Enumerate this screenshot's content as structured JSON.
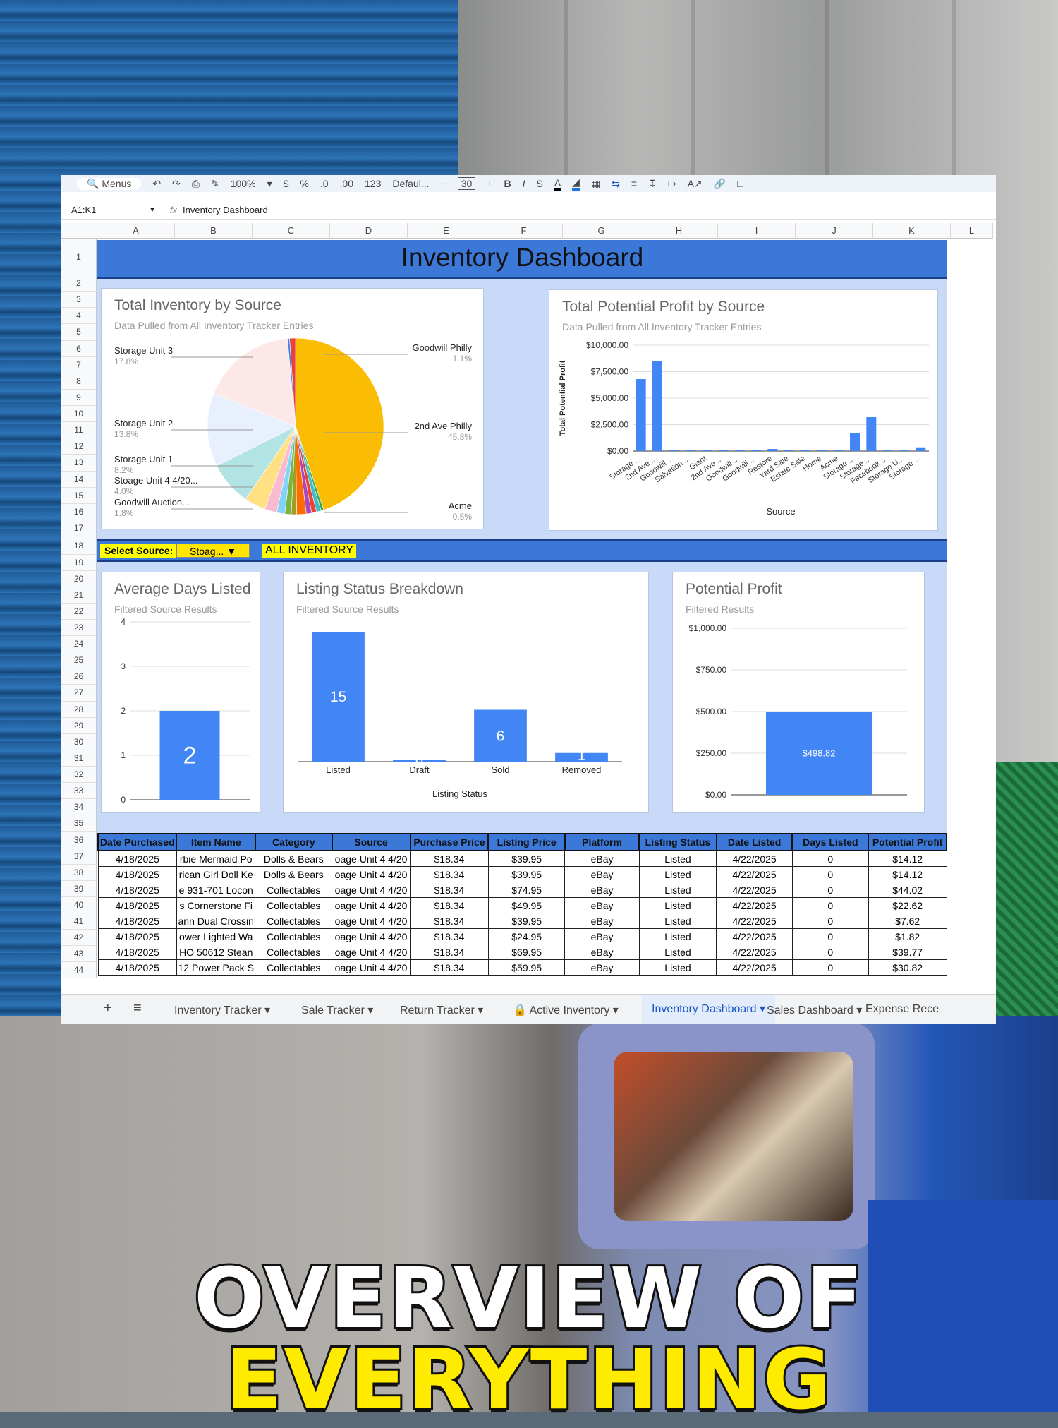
{
  "caption": {
    "line1": "OVERVIEW OF",
    "line2": "EVERYTHING"
  },
  "toolbar": {
    "menus": "Menus",
    "zoom": "100%",
    "currency": "$",
    "percent": "%",
    "dec_less": ".0",
    "dec_more": ".00",
    "number_format": "123",
    "font": "Defaul...",
    "font_size": "30",
    "bold": "B",
    "italic": "I",
    "strike": "S",
    "text_color": "A"
  },
  "formula": {
    "cell_ref": "A1:K1",
    "fx": "fx",
    "content": "Inventory Dashboard"
  },
  "columns": [
    "A",
    "B",
    "C",
    "D",
    "E",
    "F",
    "G",
    "H",
    "I",
    "J",
    "K",
    "L"
  ],
  "rows": [
    "1",
    "2",
    "3",
    "4",
    "5",
    "6",
    "7",
    "8",
    "9",
    "10",
    "11",
    "12",
    "13",
    "14",
    "15",
    "16",
    "17",
    "18",
    "19",
    "20",
    "21",
    "22",
    "23",
    "24",
    "25",
    "26",
    "27",
    "28",
    "29",
    "30",
    "31",
    "32",
    "33",
    "34",
    "35",
    "36",
    "37",
    "38",
    "39",
    "40",
    "41",
    "42",
    "43",
    "44"
  ],
  "dashboard": {
    "title": "Inventory Dashboard"
  },
  "pie_card": {
    "title": "Total Inventory by Source",
    "subtitle": "Data Pulled from All Inventory Tracker Entries"
  },
  "profit_card": {
    "title": "Total Potential Profit by Source",
    "subtitle": "Data Pulled from All Inventory Tracker Entries",
    "ylabel": "Total Potential Profit",
    "xlabel": "Source"
  },
  "selector": {
    "label": "Select Source:",
    "value": "Stoag...",
    "all": "ALL INVENTORY"
  },
  "days_card": {
    "title": "Average Days Listed",
    "subtitle": "Filtered Source Results"
  },
  "status_card": {
    "title": "Listing Status Breakdown",
    "subtitle": "Filtered Source Results",
    "xlabel": "Listing Status"
  },
  "pp_card": {
    "title": "Potential Profit",
    "subtitle": "Filtered Results"
  },
  "chart_data": [
    {
      "type": "pie",
      "title": "Total Inventory by Source",
      "subtitle": "Data Pulled from All Inventory Tracker Entries",
      "slices": [
        {
          "label": "2nd Ave Philly",
          "value": 45.8,
          "pct": "45.8%",
          "color": "#fbbc04"
        },
        {
          "label": "Acme",
          "value": 0.5,
          "pct": "0.5%",
          "color": "#34a853"
        },
        {
          "label": "",
          "value": 0.9,
          "pct": "",
          "color": "#46bdc6"
        },
        {
          "label": "",
          "value": 0.9,
          "pct": "",
          "color": "#ea4335"
        },
        {
          "label": "",
          "value": 1.0,
          "pct": "",
          "color": "#ab47bc"
        },
        {
          "label": "Goodwill Auction...",
          "value": 1.8,
          "pct": "1.8%",
          "color": "#ff6d01"
        },
        {
          "label": "",
          "value": 1.0,
          "pct": "",
          "color": "#9e9d24"
        },
        {
          "label": "",
          "value": 1.2,
          "pct": "",
          "color": "#7cb342"
        },
        {
          "label": "",
          "value": 1.5,
          "pct": "",
          "color": "#81d4fa"
        },
        {
          "label": "",
          "value": 2.3,
          "pct": "",
          "color": "#f8bbd0"
        },
        {
          "label": "Stoage Unit 4 4/20...",
          "value": 4.0,
          "pct": "4.0%",
          "color": "#ffe082"
        },
        {
          "label": "Storage Unit 1",
          "value": 8.2,
          "pct": "8.2%",
          "color": "#b2e4e4"
        },
        {
          "label": "Storage Unit 2",
          "value": 13.8,
          "pct": "13.8%",
          "color": "#e8f0fe"
        },
        {
          "label": "Storage Unit 3",
          "value": 17.8,
          "pct": "17.8%",
          "color": "#fce8e6"
        },
        {
          "label": "",
          "value": 0.4,
          "pct": "",
          "color": "#4285f4"
        },
        {
          "label": "Goodwill Philly",
          "value": 1.1,
          "pct": "1.1%",
          "color": "#ea4335"
        }
      ]
    },
    {
      "type": "bar",
      "title": "Total Potential Profit by Source",
      "subtitle": "Data Pulled from All Inventory Tracker Entries",
      "xlabel": "Source",
      "ylabel": "Total Potential Profit",
      "ylim": [
        0,
        10000
      ],
      "yticks": [
        "$0.00",
        "$2,500.00",
        "$5,000.00",
        "$7,500.00",
        "$10,000.00"
      ],
      "grid": true,
      "categories": [
        "Storage ...",
        "2nd Ave ...",
        "Goodwill ...",
        "Salvation ...",
        "Giant",
        "2nd Ave ...",
        "Goodwill ...",
        "Goodwill ...",
        "Restore",
        "Yard Sale",
        "Estate Sale",
        "Home",
        "Acme",
        "Storage ...",
        "Storage ...",
        "Facebook ...",
        "Storage U...",
        "Storage ..."
      ],
      "values": [
        6800,
        8500,
        120,
        40,
        20,
        30,
        40,
        30,
        200,
        40,
        30,
        40,
        60,
        1700,
        3200,
        60,
        20,
        350
      ]
    },
    {
      "type": "bar",
      "title": "Average Days Listed",
      "subtitle": "Filtered Source Results",
      "categories": [
        ""
      ],
      "values": [
        2
      ],
      "ylim": [
        0,
        4
      ],
      "yticks": [
        "0",
        "1",
        "2",
        "3",
        "4"
      ],
      "data_labels": [
        "2"
      ]
    },
    {
      "type": "bar",
      "title": "Listing Status Breakdown",
      "subtitle": "Filtered Source Results",
      "xlabel": "Listing Status",
      "categories": [
        "Listed",
        "Draft",
        "Sold",
        "Removed"
      ],
      "values": [
        15,
        0,
        6,
        1
      ],
      "ylim": [
        0,
        16
      ],
      "data_labels": [
        "15",
        "0",
        "6",
        "1"
      ]
    },
    {
      "type": "bar",
      "title": "Potential Profit",
      "subtitle": "Filtered Results",
      "categories": [
        ""
      ],
      "values": [
        498.82
      ],
      "ylim": [
        0,
        1000
      ],
      "yticks": [
        "$0.00",
        "$250.00",
        "$500.00",
        "$750.00",
        "$1,000.00"
      ],
      "data_labels": [
        "$498.82"
      ]
    }
  ],
  "table": {
    "headers": [
      "Date Purchased",
      "Item Name",
      "Category",
      "Source",
      "Purchase Price",
      "Listing Price",
      "Platform",
      "Listing Status",
      "Date Listed",
      "Days Listed",
      "Potential Profit"
    ],
    "rows": [
      [
        "4/18/2025",
        "rbie Mermaid Po",
        "Dolls & Bears",
        "oage Unit 4 4/20",
        "$18.34",
        "$39.95",
        "eBay",
        "Listed",
        "4/22/2025",
        "0",
        "$14.12"
      ],
      [
        "4/18/2025",
        "rican Girl Doll Ke",
        "Dolls & Bears",
        "oage Unit 4 4/20",
        "$18.34",
        "$39.95",
        "eBay",
        "Listed",
        "4/22/2025",
        "0",
        "$14.12"
      ],
      [
        "4/18/2025",
        "e 931-701 Locon",
        "Collectables",
        "oage Unit 4 4/20",
        "$18.34",
        "$74.95",
        "eBay",
        "Listed",
        "4/22/2025",
        "0",
        "$44.02"
      ],
      [
        "4/18/2025",
        "s Cornerstone Fi",
        "Collectables",
        "oage Unit 4 4/20",
        "$18.34",
        "$49.95",
        "eBay",
        "Listed",
        "4/22/2025",
        "0",
        "$22.62"
      ],
      [
        "4/18/2025",
        "ann Dual Crossin",
        "Collectables",
        "oage Unit 4 4/20",
        "$18.34",
        "$39.95",
        "eBay",
        "Listed",
        "4/22/2025",
        "0",
        "$7.62"
      ],
      [
        "4/18/2025",
        "ower Lighted Wa",
        "Collectables",
        "oage Unit 4 4/20",
        "$18.34",
        "$24.95",
        "eBay",
        "Listed",
        "4/22/2025",
        "0",
        "$1.82"
      ],
      [
        "4/18/2025",
        "HO 50612 Stean",
        "Collectables",
        "oage Unit 4 4/20",
        "$18.34",
        "$69.95",
        "eBay",
        "Listed",
        "4/22/2025",
        "0",
        "$39.77"
      ],
      [
        "4/18/2025",
        "12 Power Pack S",
        "Collectables",
        "oage Unit 4 4/20",
        "$18.34",
        "$59.95",
        "eBay",
        "Listed",
        "4/22/2025",
        "0",
        "$30.82"
      ]
    ]
  },
  "tabs": {
    "add": "+",
    "all_sheets": "≡",
    "items": [
      "Inventory Tracker",
      "Sale Tracker",
      "Return Tracker",
      "Active Inventory",
      "Inventory Dashboard",
      "Sales Dashboard",
      "Expense Rece"
    ],
    "active": "Inventory Dashboard",
    "locked_icon": "🔒"
  }
}
